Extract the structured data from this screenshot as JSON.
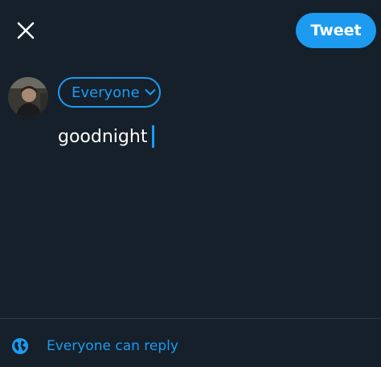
{
  "header": {
    "close_icon": "close-icon",
    "tweet_label": "Tweet"
  },
  "composer": {
    "avatar_icon": "avatar",
    "audience_label": "Everyone",
    "audience_chevron": "chevron-down-icon",
    "text": "goodnight"
  },
  "footer": {
    "reply_icon": "globe-icon",
    "reply_label": "Everyone can reply"
  },
  "colors": {
    "background": "#15202b",
    "accent": "#1d9bf0",
    "text": "#ffffff",
    "divider": "#2f3b47"
  }
}
